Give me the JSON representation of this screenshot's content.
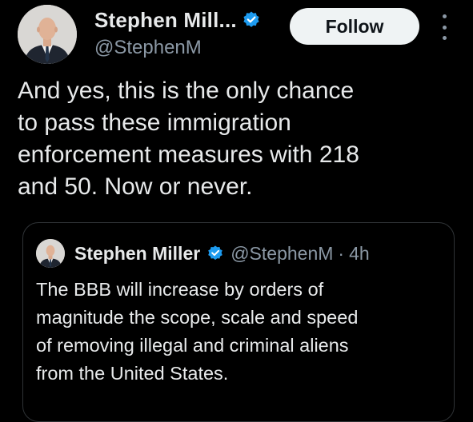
{
  "author": {
    "display_name": "Stephen Mill...",
    "handle": "@StephenM",
    "avatar_icon": "profile-photo",
    "verified_icon": "verified-badge-icon"
  },
  "follow_button": {
    "label": "Follow"
  },
  "more_menu": {
    "icon": "more-vertical-icon"
  },
  "tweet": {
    "text": "And yes, this is the only chance\nto pass these immigration\nenforcement measures with 218\nand 50. Now or never."
  },
  "quoted_tweet": {
    "display_name": "Stephen Miller",
    "handle": "@StephenM",
    "separator": "·",
    "time": "4h",
    "text": "The BBB will increase by orders of\nmagnitude the scope, scale and speed\nof removing illegal and criminal aliens\nfrom the United States."
  },
  "colors": {
    "background": "#000000",
    "text_primary": "#e7e9ea",
    "text_secondary": "#8b98a5",
    "verified_blue": "#1d9bf0",
    "follow_button_bg": "#eff3f4",
    "border": "#2f3336"
  }
}
